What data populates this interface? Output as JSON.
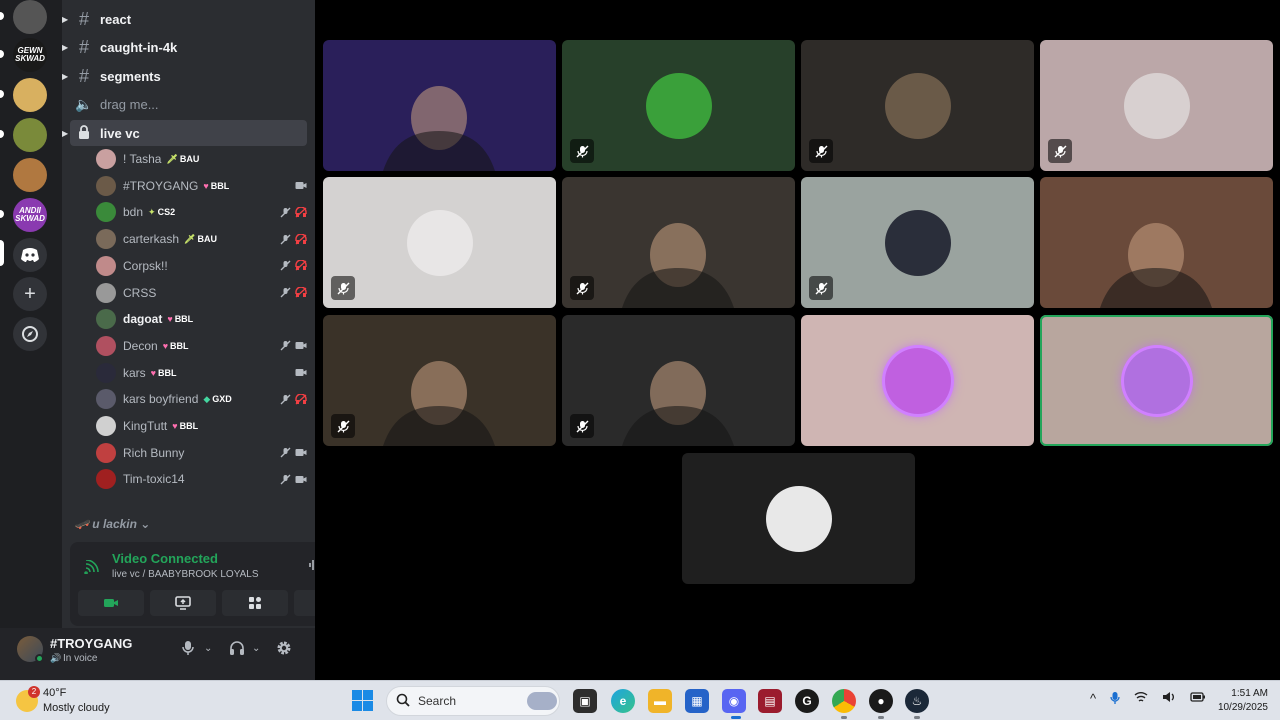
{
  "channels": {
    "text_channels": [
      {
        "name": "react"
      },
      {
        "name": "caught-in-4k"
      },
      {
        "name": "segments"
      }
    ],
    "voice_channel_muted": "drag me...",
    "active_voice_channel": "live vc",
    "voice_users": [
      {
        "name": "! Tasha",
        "tag_icon": "🗡",
        "tag": "BAU",
        "bold": false,
        "icons": [],
        "color": "#c9a0a0"
      },
      {
        "name": "#TROYGANG",
        "tag_icon": "♥",
        "tag": "BBL",
        "bold": false,
        "icons": [
          "camera"
        ],
        "color": "#6b5a48"
      },
      {
        "name": "bdn",
        "tag_icon": "✦",
        "tag": "CS2",
        "bold": false,
        "icons": [
          "mute",
          "deafen"
        ],
        "color": "#3a8a3a"
      },
      {
        "name": "carterkash",
        "tag_icon": "🗡",
        "tag": "BAU",
        "bold": false,
        "icons": [
          "mute",
          "deafen"
        ],
        "color": "#7a6a5a"
      },
      {
        "name": "Corpsk!!",
        "tag_icon": "",
        "tag": "",
        "bold": false,
        "icons": [
          "mute",
          "deafen"
        ],
        "color": "#c08a8a"
      },
      {
        "name": "CRSS",
        "tag_icon": "",
        "tag": "",
        "bold": false,
        "icons": [
          "mute",
          "deafen"
        ],
        "color": "#999999"
      },
      {
        "name": "dagoat",
        "tag_icon": "♥",
        "tag": "BBL",
        "bold": true,
        "icons": [],
        "color": "#4a6a4a"
      },
      {
        "name": "Decon",
        "tag_icon": "♥",
        "tag": "BBL",
        "bold": false,
        "icons": [
          "mute",
          "camera"
        ],
        "color": "#b05060"
      },
      {
        "name": "kars",
        "tag_icon": "♥",
        "tag": "BBL",
        "bold": false,
        "icons": [
          "camera"
        ],
        "color": "#2a2a3a"
      },
      {
        "name": "kars boyfriend",
        "tag_icon": "◆",
        "tag": "GXD",
        "bold": false,
        "icons": [
          "mute",
          "deafen"
        ],
        "color": "#5a5a6a"
      },
      {
        "name": "KingTutt",
        "tag_icon": "♥",
        "tag": "BBL",
        "bold": false,
        "icons": [],
        "color": "#d0d0d0"
      },
      {
        "name": "Rich Bunny",
        "tag_icon": "",
        "tag": "",
        "bold": false,
        "icons": [
          "mute",
          "camera"
        ],
        "color": "#c04040"
      },
      {
        "name": "Tim-toxic14",
        "tag_icon": "",
        "tag": "",
        "bold": false,
        "icons": [
          "mute",
          "camera"
        ],
        "color": "#a02020"
      }
    ],
    "category": "u lackin"
  },
  "voice_panel": {
    "title": "Video Connected",
    "subtitle": "live vc / BAABYBROOK LOYALS"
  },
  "user_bar": {
    "name": "#TROYGANG",
    "status": "In voice"
  },
  "servers": [
    {
      "label": "",
      "color": "#555555"
    },
    {
      "label": "GEWN SKWAD",
      "color": "#1a1a1a"
    },
    {
      "label": "",
      "color": "#d8b060"
    },
    {
      "label": "",
      "color": "#7a8a3a"
    },
    {
      "label": "",
      "color": "#b07840"
    },
    {
      "label": "ANDII SKWAD",
      "color": "#8a3ab0"
    }
  ],
  "tiles": [
    {
      "bg": "#2a1f5a",
      "kind": "cam",
      "muted": false,
      "avatar": ""
    },
    {
      "bg": "#27402a",
      "kind": "avatar",
      "muted": true,
      "avatar": "#3aa03a"
    },
    {
      "bg": "#2e2b28",
      "kind": "avatar",
      "muted": true,
      "avatar": "#6a5a48"
    },
    {
      "bg": "#bba7a8",
      "kind": "avatar",
      "muted": true,
      "avatar": "#d8d0d0"
    },
    {
      "bg": "#d4d2d1",
      "kind": "avatar",
      "muted": true,
      "avatar": "#e8e6e6"
    },
    {
      "bg": "#3a3530",
      "kind": "cam",
      "muted": true,
      "avatar": ""
    },
    {
      "bg": "#9aa39f",
      "kind": "avatar",
      "muted": true,
      "avatar": "#2a2e3a"
    },
    {
      "bg": "#6a4a3a",
      "kind": "cam",
      "muted": false,
      "avatar": ""
    },
    {
      "bg": "#3a3228",
      "kind": "cam",
      "muted": true,
      "avatar": ""
    },
    {
      "bg": "#2a2a2a",
      "kind": "cam",
      "muted": true,
      "avatar": ""
    },
    {
      "bg": "#cfb5b3",
      "kind": "avatar",
      "muted": false,
      "avatar": "#c060e0"
    },
    {
      "bg": "#b8a69e",
      "kind": "avatar",
      "muted": false,
      "avatar": "#b070e0"
    },
    {
      "bg": "#1f1f1f",
      "kind": "avatar",
      "muted": false,
      "avatar": "#e8e8e8"
    }
  ],
  "taskbar": {
    "weather_badge": "2",
    "weather_temp": "40°F",
    "weather_desc": "Mostly cloudy",
    "search_placeholder": "Search",
    "time": "1:51 AM",
    "date": "10/29/2025"
  }
}
